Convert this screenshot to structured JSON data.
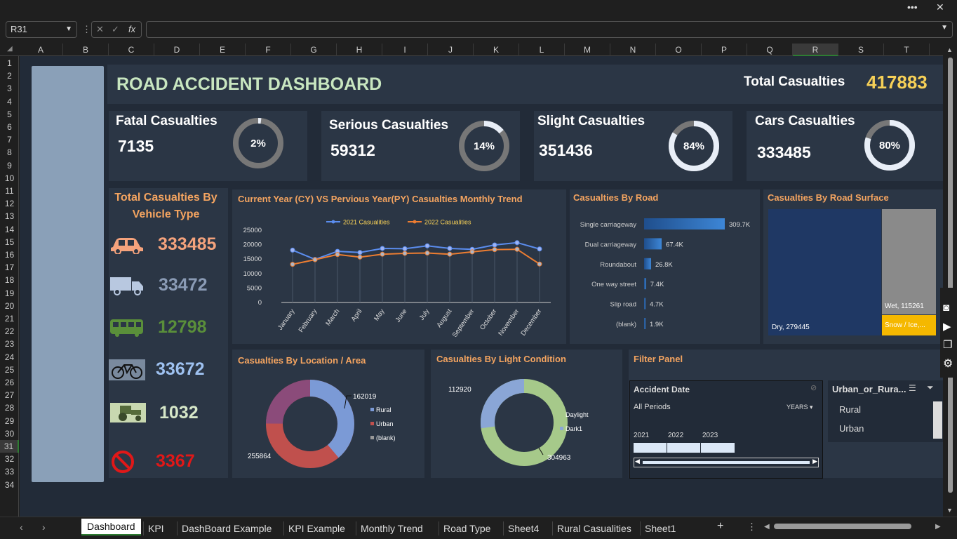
{
  "window": {
    "more_label": "•••",
    "close_label": "✕"
  },
  "formula_bar": {
    "name_box": "R31",
    "fx": "fx",
    "content": ""
  },
  "columns": [
    "A",
    "B",
    "C",
    "D",
    "E",
    "F",
    "G",
    "H",
    "I",
    "J",
    "K",
    "L",
    "M",
    "N",
    "O",
    "P",
    "Q",
    "R",
    "S",
    "T"
  ],
  "rows": [
    "1",
    "2",
    "3",
    "4",
    "5",
    "6",
    "7",
    "8",
    "9",
    "10",
    "11",
    "12",
    "13",
    "14",
    "15",
    "16",
    "17",
    "18",
    "19",
    "20",
    "21",
    "22",
    "23",
    "24",
    "25",
    "26",
    "27",
    "28",
    "29",
    "30",
    "31",
    "32",
    "33",
    "34"
  ],
  "dashboard": {
    "title": "ROAD ACCIDENT DASHBOARD",
    "total_label": "Total Casualties",
    "total_value": "417883",
    "kpis": [
      {
        "label": "Fatal Casualties",
        "value": "7135",
        "pct_text": "2%",
        "pct": 0.02
      },
      {
        "label": "Serious Casualties",
        "value": "59312",
        "pct_text": "14%",
        "pct": 0.14
      },
      {
        "label": "Slight Casualties",
        "value": "351436",
        "pct_text": "84%",
        "pct": 0.84
      },
      {
        "label": "Cars Casualties",
        "value": "333485",
        "pct_text": "80%",
        "pct": 0.8
      }
    ],
    "vehicle": {
      "title_line1": "Total Casualties By",
      "title_line2": "Vehicle Type",
      "items": [
        {
          "icon": "car-icon",
          "value": "333485",
          "color": "#f4a27c"
        },
        {
          "icon": "truck-icon",
          "value": "33472",
          "color": "#8a9bb5"
        },
        {
          "icon": "bus-icon",
          "value": "12798",
          "color": "#5a8f3a"
        },
        {
          "icon": "bicycle-icon",
          "value": "33672",
          "color": "#9ec1f0"
        },
        {
          "icon": "tractor-icon",
          "value": "1032",
          "color": "#d6e7c8"
        },
        {
          "icon": "no-entry-icon",
          "value": "3367",
          "color": "#e01818"
        }
      ]
    },
    "trend": {
      "title": "Current Year (CY) VS Pervious Year(PY) Casualties Monthly Trend",
      "legend": [
        "2021 Casualities",
        "2022 Casualities"
      ],
      "yticks": [
        "25000",
        "20000",
        "15000",
        "10000",
        "5000",
        "0"
      ]
    },
    "road": {
      "title": "Casualties By Road"
    },
    "surface": {
      "title": "Casualties By Road Surface",
      "dry_label": "Dry, 279445",
      "wet_label": "Wet, 115261",
      "snow_label": "Snow / Ice,..."
    },
    "location": {
      "title": "Casualties By Location / Area",
      "label_rural": "162019",
      "label_urban": "255864",
      "legend": [
        "Rural",
        "Urban",
        "(blank)"
      ]
    },
    "light": {
      "title": "Casualties By Light Condition",
      "label_dark": "112920",
      "label_day": "304963",
      "legend": [
        "Daylight",
        "Dark1"
      ]
    },
    "filter": {
      "title": "Filter Panel",
      "date_header": "Accident Date",
      "periods": "All Periods",
      "years_label": "YEARS",
      "years": [
        "2021",
        "2022",
        "2023"
      ],
      "urban_header": "Urban_or_Rura...",
      "urban_items": [
        "Rural",
        "Urban"
      ]
    }
  },
  "chart_data": [
    {
      "type": "line",
      "title": "Current Year (CY) VS Pervious Year(PY) Casualties Monthly Trend",
      "categories": [
        "January",
        "February",
        "March",
        "April",
        "May",
        "June",
        "July",
        "August",
        "September",
        "October",
        "November",
        "December"
      ],
      "ylim": [
        0,
        25000
      ],
      "series": [
        {
          "name": "2021 Casualities",
          "color": "#5b8def",
          "values": [
            18100,
            14900,
            17700,
            17300,
            18700,
            18600,
            19600,
            18700,
            18400,
            19900,
            20700,
            18500
          ]
        },
        {
          "name": "2022 Casualities",
          "color": "#ed7d31",
          "values": [
            13200,
            14800,
            16600,
            15700,
            16700,
            17000,
            17100,
            16700,
            17500,
            18300,
            18400,
            13300
          ]
        }
      ]
    },
    {
      "type": "bar",
      "title": "Casualties By Road",
      "categories": [
        "Single carriageway",
        "Dual carriageway",
        "Roundabout",
        "One way street",
        "Slip road",
        "(blank)"
      ],
      "values": [
        309700,
        67400,
        26800,
        7400,
        4700,
        1900
      ],
      "labels": [
        "309.7K",
        "67.4K",
        "26.8K",
        "7.4K",
        "4.7K",
        "1.9K"
      ]
    },
    {
      "type": "heatmap",
      "title": "Casualties By Road Surface",
      "categories": [
        "Dry",
        "Wet",
        "Snow / Ice"
      ],
      "values": [
        279445,
        115261,
        23177
      ]
    },
    {
      "type": "pie",
      "title": "Casualties By Location / Area",
      "categories": [
        "Rural",
        "Urban",
        "(blank)"
      ],
      "values": [
        162019,
        255864,
        0
      ]
    },
    {
      "type": "pie",
      "title": "Casualties By Light Condition",
      "categories": [
        "Daylight",
        "Dark1"
      ],
      "values": [
        304963,
        112920
      ]
    }
  ],
  "sheet_tabs": [
    "Dashboard",
    "KPI",
    "DashBoard Example",
    "KPI Example",
    "Monthly Trend",
    "Road Type",
    "Sheet4",
    "Rural Casualities",
    "Sheet1"
  ]
}
